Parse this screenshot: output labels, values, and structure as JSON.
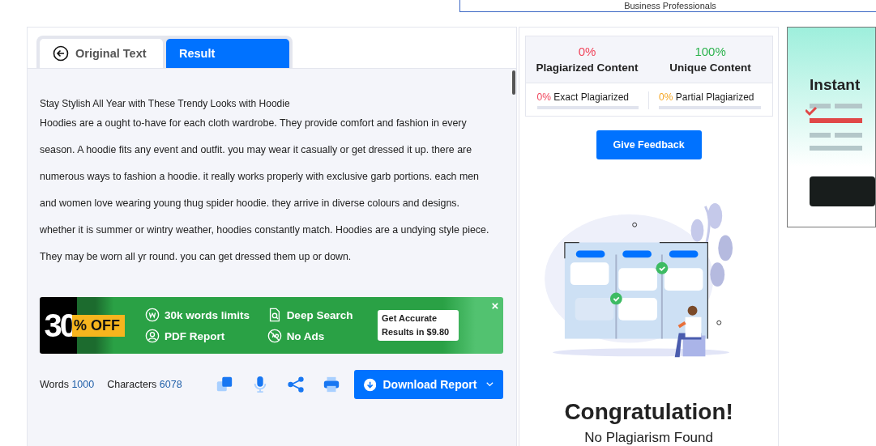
{
  "top_box": {
    "text": "Business Professionals"
  },
  "tabs": [
    {
      "label": "Original Text",
      "selected": false,
      "kind": "back"
    },
    {
      "label": "Result",
      "selected": true,
      "kind": "plain"
    }
  ],
  "document": {
    "title": "Stay Stylish All Year with These Trendy Looks with Hoodie",
    "body": "Hoodies are a ought to-have for each cloth wardrobe. They provide comfort and fashion in every season. A hoodie fits any event and outfit. you may wear it casually or get dressed it up. there are numerous ways to fashion a hoodie. it really works properly with exclusive garb portions. each men and women love wearing young thug spider hoodie. they arrive in diverse colours and designs. whether it is summer or wintry weather, hoodies constantly match. Hoodies are a undying style piece. They may be worn all yr round. you can get dressed them up or down."
  },
  "promo": {
    "big": "30",
    "tag": "% OFF",
    "features": [
      {
        "kind": "words",
        "label": "30k words limits"
      },
      {
        "kind": "search",
        "label": "Deep Search"
      },
      {
        "kind": "pdf",
        "label": "PDF Report"
      },
      {
        "kind": "noads",
        "label": "No Ads"
      }
    ],
    "cta": "Get Accurate Results in $9.80",
    "close": "×"
  },
  "stats": [
    {
      "label": "Words",
      "value": "1000"
    },
    {
      "label": "Characters",
      "value": "6078"
    }
  ],
  "tools": [
    {
      "kind": "copy"
    },
    {
      "kind": "mic"
    },
    {
      "kind": "share"
    },
    {
      "kind": "print"
    }
  ],
  "download": {
    "label": "Download Report"
  },
  "summary": [
    {
      "value": "0%",
      "label": "Plagiarized Content",
      "color": "#f0445a"
    },
    {
      "value": "100%",
      "label": "Unique Content",
      "color": "#2bb24c"
    }
  ],
  "breakdown": [
    {
      "value": "0%",
      "label": "Exact Plagiarized",
      "color": "#f0445a",
      "level": 0
    },
    {
      "value": "0%",
      "label": "Partial Plagiarized",
      "color": "#f5a623",
      "level": 0
    }
  ],
  "feedback": "Give Feedback",
  "result": {
    "title": "Congratulation!",
    "subtitle": "No Plagiarism Found"
  },
  "side_ad": {
    "title": "Instant"
  }
}
